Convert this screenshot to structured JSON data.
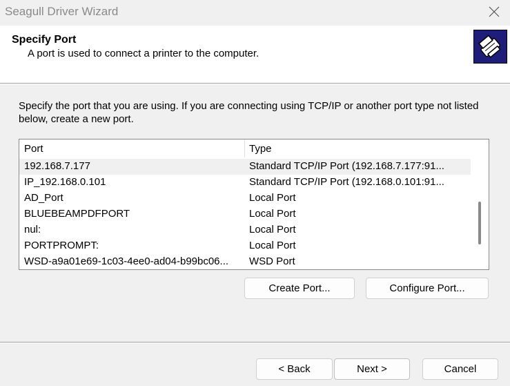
{
  "window": {
    "title": "Seagull Driver Wizard"
  },
  "header": {
    "title": "Specify Port",
    "subtitle": "A port is used to connect a printer to the computer.",
    "logo_icon": "printer-wizard-icon"
  },
  "description": "Specify the port that you are using.  If you are connecting using TCP/IP or another port type not listed below, create a new port.",
  "port_list": {
    "columns": [
      "Port",
      "Type"
    ],
    "rows": [
      {
        "port": "192.168.7.177",
        "type": "Standard TCP/IP Port (192.168.7.177:91...",
        "selected": true
      },
      {
        "port": "IP_192.168.0.101",
        "type": "Standard TCP/IP Port (192.168.0.101:91...",
        "selected": false
      },
      {
        "port": "AD_Port",
        "type": "Local Port",
        "selected": false
      },
      {
        "port": "BLUEBEAMPDFPORT",
        "type": "Local Port",
        "selected": false
      },
      {
        "port": "nul:",
        "type": "Local Port",
        "selected": false
      },
      {
        "port": "PORTPROMPT:",
        "type": "Local Port",
        "selected": false
      },
      {
        "port": "WSD-a9a01e69-1c03-4ee0-ad04-b99bc06...",
        "type": "WSD Port",
        "selected": false
      }
    ]
  },
  "buttons": {
    "create_port": "Create Port...",
    "configure_port": "Configure Port...",
    "back": "< Back",
    "next": "Next >",
    "cancel": "Cancel"
  },
  "colors": {
    "logo_bg": "#1e1e7a",
    "selected_row": "#f0f0f0"
  }
}
